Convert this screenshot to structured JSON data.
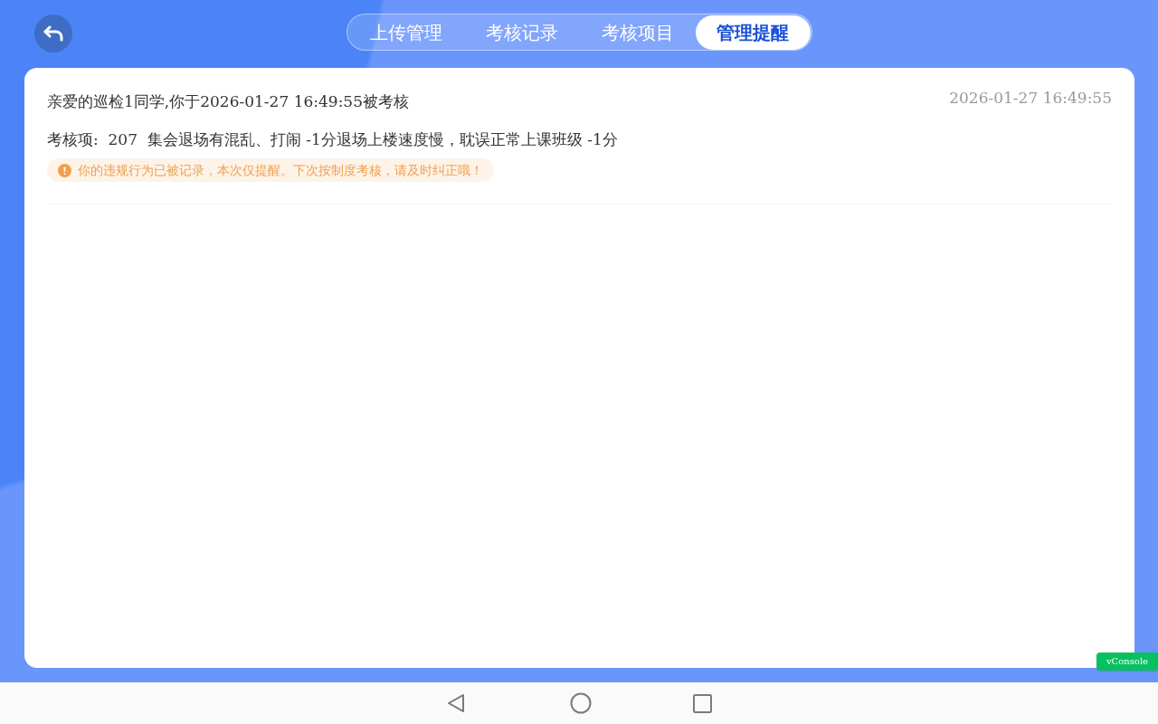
{
  "header": {
    "tabs": [
      {
        "label": "上传管理",
        "selected": false
      },
      {
        "label": "考核记录",
        "selected": false
      },
      {
        "label": "考核项目",
        "selected": false
      },
      {
        "label": "管理提醒",
        "selected": true
      }
    ]
  },
  "notifications": [
    {
      "message": "亲爱的巡检1同学,你于2026-01-27 16:49:55被考核",
      "time": "2026-01-27 16:49:55",
      "detail": "考核项:  207  集会退场有混乱、打闹 -1分退场上楼速度慢，耽误正常上课班级 -1分",
      "warning": "你的违规行为已被记录，本次仅提醒。下次按制度考核，请及时纠正哦！"
    }
  ],
  "debug_button": {
    "label": "vConsole"
  }
}
